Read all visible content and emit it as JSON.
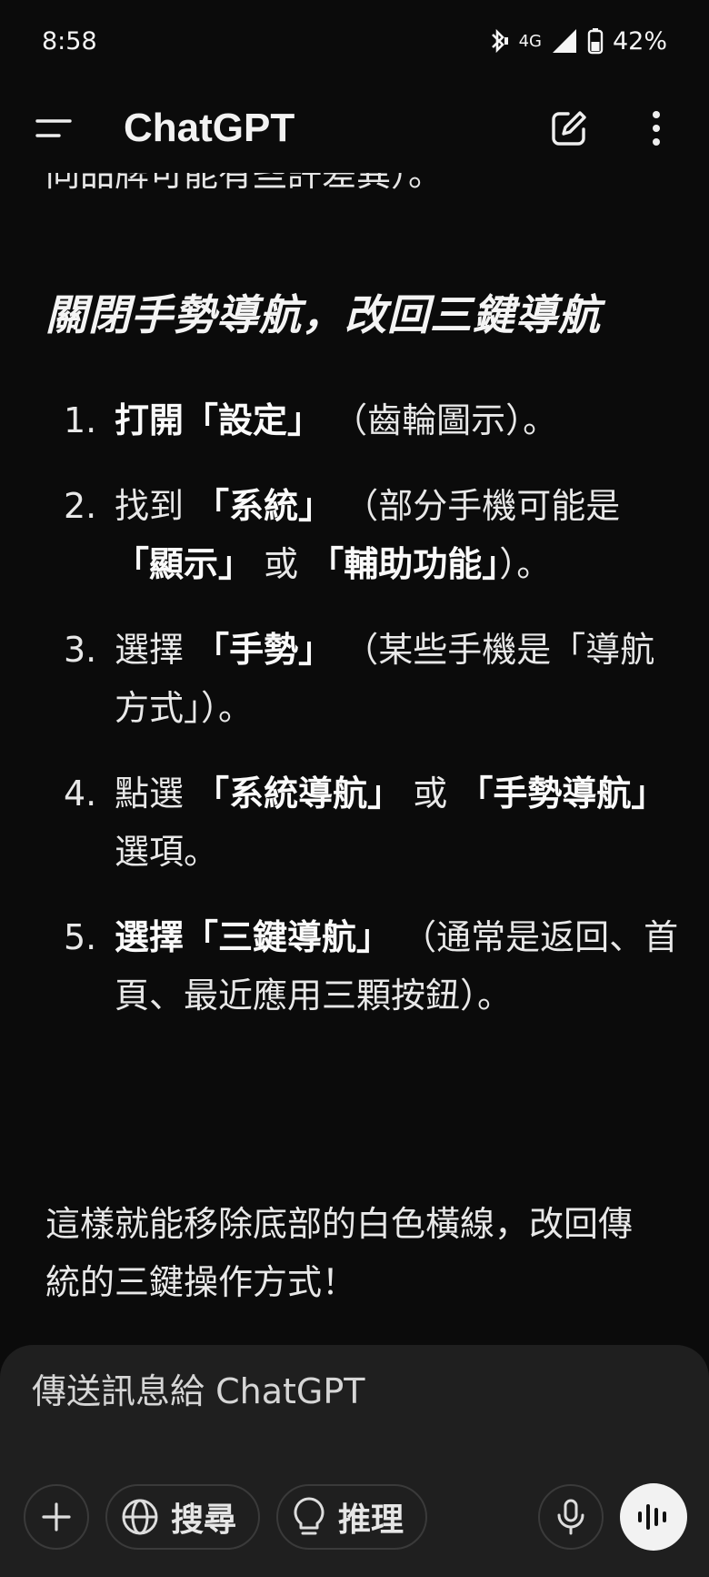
{
  "status": {
    "time": "8:58",
    "network": "4G",
    "battery": "42%"
  },
  "appbar": {
    "title": "ChatGPT",
    "icons": [
      "menu-icon",
      "new-chat-icon",
      "more-vert-icon"
    ]
  },
  "message": {
    "cut_line": "同品牌可能有些許差異）。",
    "heading": "關閉手勢導航，改回三鍵導航",
    "steps": [
      {
        "num": "1.",
        "bold": "打開「設定」",
        "rest": "（齒輪圖示）。"
      },
      {
        "num": "2.",
        "pre": "找到",
        "bold1": "「系統」",
        "mid": "（部分手機可能是",
        "bold2": "「顯示」",
        "mid2": "或",
        "bold3": "「輔助功能」",
        "end": "）。"
      },
      {
        "num": "3.",
        "pre": "選擇",
        "bold": "「手勢」",
        "rest": "（某些手機是「導航方式」）。"
      },
      {
        "num": "4.",
        "pre": "點選",
        "bold1": "「系統導航」",
        "mid": "或",
        "bold2": "「手勢導航」",
        "end": "選項。"
      },
      {
        "num": "5.",
        "bold": "選擇「三鍵導航」",
        "rest": "（通常是返回、首頁、最近應用三顆按鈕）。"
      }
    ],
    "summary": "這樣就能移除底部的白色橫線，改回傳統的三鍵操作方式！"
  },
  "composer": {
    "placeholder": "傳送訊息給 ChatGPT",
    "search_label": "搜尋",
    "reason_label": "推理"
  }
}
